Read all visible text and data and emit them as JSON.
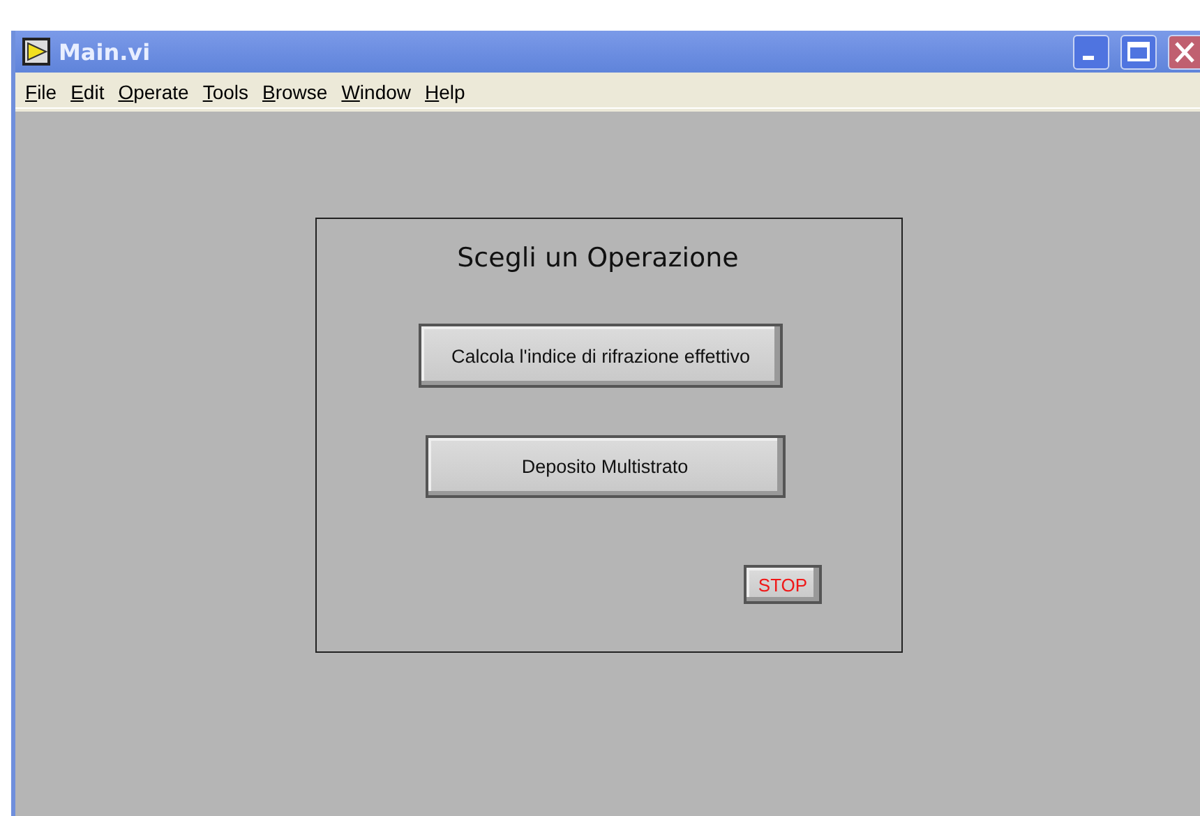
{
  "window": {
    "title": "Main.vi"
  },
  "menu": [
    "File",
    "Edit",
    "Operate",
    "Tools",
    "Browse",
    "Window",
    "Help"
  ],
  "panel": {
    "title": "Scegli un Operazione",
    "buttons": [
      "Calcola l'indice di rifrazione effettivo",
      "Deposito Multistrato"
    ],
    "stop": "STOP"
  }
}
